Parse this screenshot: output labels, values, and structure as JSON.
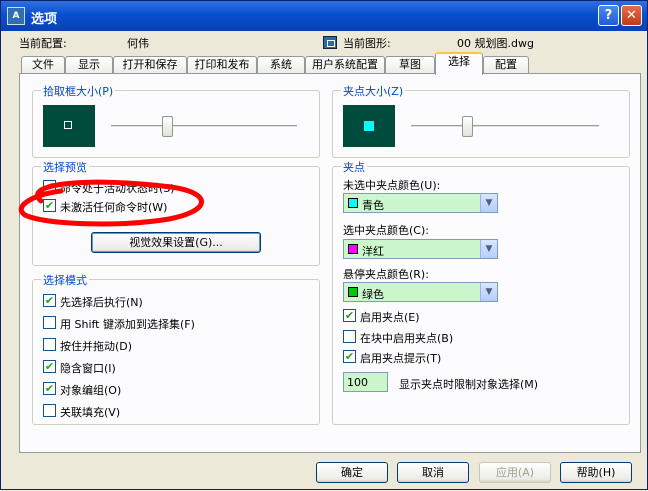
{
  "window": {
    "title": "选项",
    "app_icon_text": "A",
    "help_label": "?",
    "close_label": "✕"
  },
  "config": {
    "current_config_label": "当前配置:",
    "current_config_value": "何伟",
    "current_drawing_label": "当前图形:",
    "current_drawing_value": "00 规划图.dwg"
  },
  "tabs": [
    {
      "label": "文件"
    },
    {
      "label": "显示"
    },
    {
      "label": "打开和保存"
    },
    {
      "label": "打印和发布"
    },
    {
      "label": "系统"
    },
    {
      "label": "用户系统配置"
    },
    {
      "label": "草图"
    },
    {
      "label": "选择",
      "active": true
    },
    {
      "label": "配置"
    }
  ],
  "pickbox": {
    "title": "拾取框大小(P)",
    "preview_bg": "#004c3c",
    "slider_value": 0.3
  },
  "grip_size": {
    "title": "夹点大小(Z)",
    "preview_bg": "#004c3c",
    "grip_color": "#00ffff",
    "slider_value": 0.3
  },
  "selection_preview": {
    "title": "选择预览",
    "items": [
      {
        "label": "命令处于活动状态时(S)",
        "checked": true
      },
      {
        "label": "未激活任何命令时(W)",
        "checked": true
      }
    ],
    "settings_button": "视觉效果设置(G)..."
  },
  "selection_mode": {
    "title": "选择模式",
    "items": [
      {
        "label": "先选择后执行(N)",
        "checked": true
      },
      {
        "label": "用 Shift 键添加到选择集(F)",
        "checked": false
      },
      {
        "label": "按住并拖动(D)",
        "checked": false
      },
      {
        "label": "隐含窗口(I)",
        "checked": true
      },
      {
        "label": "对象编组(O)",
        "checked": true
      },
      {
        "label": "关联填充(V)",
        "checked": false
      }
    ]
  },
  "grips": {
    "title": "夹点",
    "unselected_label": "未选中夹点颜色(U):",
    "unselected_value": "青色",
    "unselected_color": "#00ffff",
    "selected_label": "选中夹点颜色(C):",
    "selected_value": "洋红",
    "selected_color": "#ff00ff",
    "hover_label": "悬停夹点颜色(R):",
    "hover_value": "绿色",
    "hover_color": "#00cc00",
    "enable_grips": {
      "label": "启用夹点(E)",
      "checked": true
    },
    "grips_in_blocks": {
      "label": "在块中启用夹点(B)",
      "checked": false
    },
    "grip_tips": {
      "label": "启用夹点提示(T)",
      "checked": true
    },
    "limit_value": "100",
    "limit_label": "显示夹点时限制对象选择(M)"
  },
  "buttons": {
    "ok": "确定",
    "cancel": "取消",
    "apply": "应用(A)",
    "help": "帮助(H)"
  },
  "colors": {
    "annotation": "#ff0000",
    "group_title": "#0046d5"
  }
}
